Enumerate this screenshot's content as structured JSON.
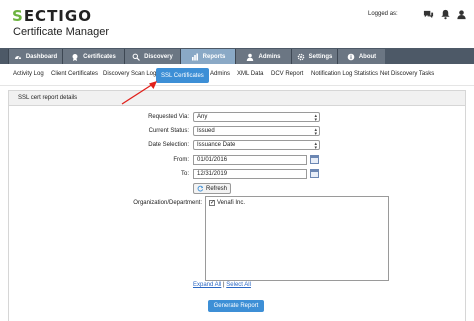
{
  "header": {
    "logo_s": "S",
    "logo_rest": "ECTIGO",
    "product": "Certificate Manager",
    "logged_in_label": "Logged as:",
    "icons": [
      "chat-icon",
      "bell-icon",
      "user-icon"
    ]
  },
  "nav": {
    "tabs": [
      {
        "label": "Dashboard",
        "icon": "dashboard-icon"
      },
      {
        "label": "Certificates",
        "icon": "certificate-icon"
      },
      {
        "label": "Discovery",
        "icon": "discovery-icon"
      },
      {
        "label": "Reports",
        "icon": "reports-icon",
        "active": true
      },
      {
        "label": "Admins",
        "icon": "admins-icon"
      },
      {
        "label": "Settings",
        "icon": "gear-icon"
      },
      {
        "label": "About",
        "icon": "info-icon"
      }
    ]
  },
  "subnav": {
    "tabs": [
      {
        "label": "Activity Log"
      },
      {
        "label": "Client Certificates"
      },
      {
        "label": "Discovery Scan Log"
      },
      {
        "label": "SSL Certificates",
        "active": true
      },
      {
        "label": "Admins"
      },
      {
        "label": "XML Data"
      },
      {
        "label": "DCV Report"
      },
      {
        "label": "Notification Log Statistics"
      },
      {
        "label": "Net Discovery Tasks"
      }
    ]
  },
  "panel": {
    "title": "SSL cert report details"
  },
  "form": {
    "requested_via_label": "Requested Via:",
    "requested_via_value": "Any",
    "current_status_label": "Current Status:",
    "current_status_value": "Issued",
    "date_selection_label": "Date Selection:",
    "date_selection_value": "Issuance Date",
    "from_label": "From:",
    "from_value": "01/01/2016",
    "to_label": "To:",
    "to_value": "12/31/2019",
    "refresh_label": "Refresh",
    "org_label": "Organization/Department:",
    "org_items": [
      {
        "label": "Venafi Inc.",
        "checked": true
      }
    ],
    "expand_all": "Expand All",
    "select_all": "Select All",
    "generate_label": "Generate Report"
  },
  "colors": {
    "logo_accent": "#6cb33f",
    "nav_bg": "#4d5967",
    "nav_tab": "#6b7683",
    "nav_active": "#8aa9c6",
    "primary": "#3d8fd6",
    "annotation_arrow": "#e0211c"
  }
}
